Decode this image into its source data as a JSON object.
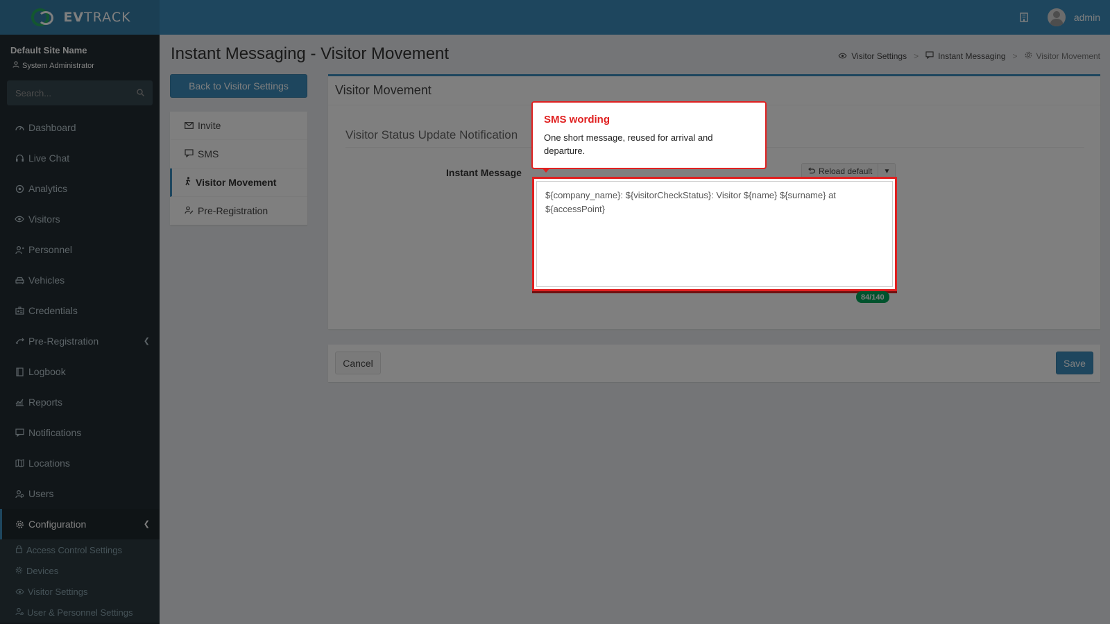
{
  "app": {
    "logo_prefix": "EV",
    "logo_suffix": "TRACK"
  },
  "topbar": {
    "username": "admin"
  },
  "sidebar": {
    "site_name": "Default Site Name",
    "role": "System Administrator",
    "search_placeholder": "Search...",
    "items": [
      {
        "label": "Dashboard",
        "icon": "dashboard-icon"
      },
      {
        "label": "Live Chat",
        "icon": "headset-icon"
      },
      {
        "label": "Analytics",
        "icon": "analytics-icon"
      },
      {
        "label": "Visitors",
        "icon": "eye-icon"
      },
      {
        "label": "Personnel",
        "icon": "personnel-icon"
      },
      {
        "label": "Vehicles",
        "icon": "car-icon"
      },
      {
        "label": "Credentials",
        "icon": "id-card-icon"
      },
      {
        "label": "Pre-Registration",
        "icon": "arrows-icon"
      },
      {
        "label": "Logbook",
        "icon": "book-icon"
      },
      {
        "label": "Reports",
        "icon": "chart-icon"
      },
      {
        "label": "Notifications",
        "icon": "chat-icon"
      },
      {
        "label": "Locations",
        "icon": "map-icon"
      },
      {
        "label": "Users",
        "icon": "users-icon"
      },
      {
        "label": "Configuration",
        "icon": "gear-icon"
      }
    ],
    "sub_items": [
      {
        "label": "Access Control Settings",
        "icon": "lock-icon"
      },
      {
        "label": "Devices",
        "icon": "devices-icon"
      },
      {
        "label": "Visitor Settings",
        "icon": "eye-icon"
      },
      {
        "label": "User & Personnel Settings",
        "icon": "user-settings-icon"
      }
    ]
  },
  "page": {
    "title": "Instant Messaging - Visitor Movement",
    "breadcrumb": [
      "Visitor Settings",
      "Instant Messaging",
      "Visitor Movement"
    ],
    "back_button": "Back to Visitor Settings",
    "left_menu": [
      {
        "label": "Invite",
        "icon": "envelope-icon"
      },
      {
        "label": "SMS",
        "icon": "message-icon"
      },
      {
        "label": "Visitor Movement",
        "icon": "walking-icon"
      },
      {
        "label": "Pre-Registration",
        "icon": "user-pen-icon"
      }
    ],
    "panel_title": "Visitor Movement",
    "section_title": "Visitor Status Update Notification",
    "field_label": "Instant Message",
    "reload_default": "Reload default",
    "message_value": "${company_name}: ${visitorCheckStatus}: Visitor ${name} ${surname} at ${accessPoint}",
    "char_count": "84/140",
    "cancel": "Cancel",
    "save": "Save"
  },
  "callout": {
    "title": "SMS wording",
    "body": "One short message, reused for arrival and departure."
  },
  "colors": {
    "brand": "#3c8dbc",
    "sidebar": "#222d32",
    "highlight": "#e02020",
    "badge": "#00a65a"
  }
}
